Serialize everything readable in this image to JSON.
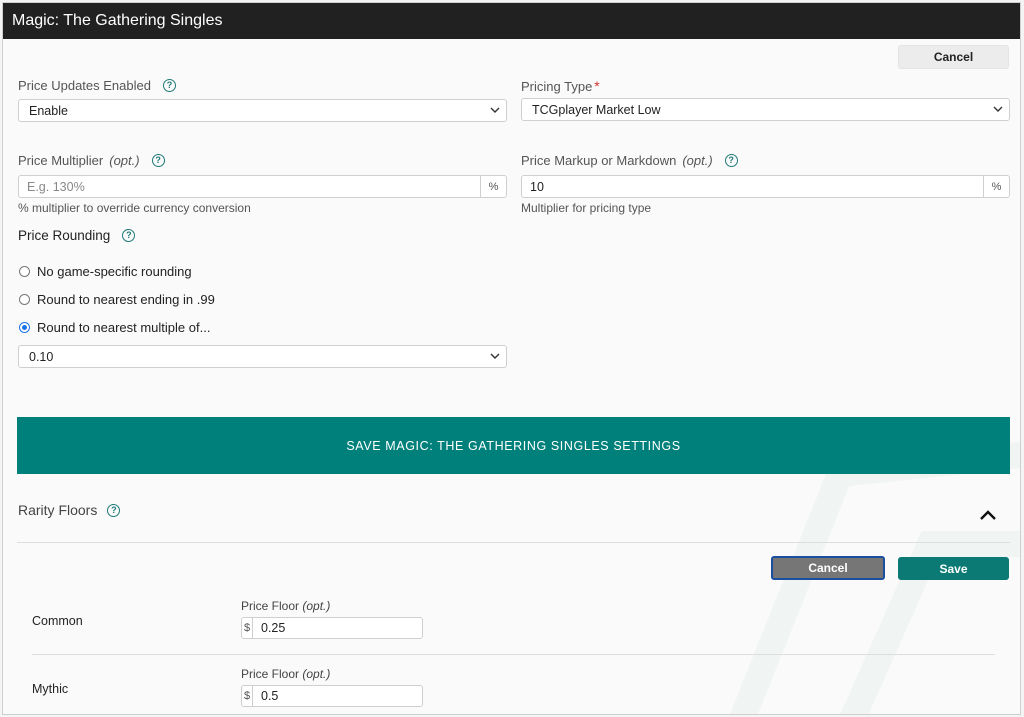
{
  "window": {
    "title": "Magic: The Gathering Singles"
  },
  "top_cancel_label": "Cancel",
  "price_updates": {
    "label": "Price Updates Enabled",
    "value": "Enable"
  },
  "pricing_type": {
    "label": "Pricing Type",
    "required_mark": "*",
    "value": "TCGplayer Market Low"
  },
  "price_multiplier": {
    "label": "Price Multiplier",
    "opt": "(opt.)",
    "placeholder": "E.g. 130%",
    "value": "",
    "unit": "%",
    "hint": "% multiplier to override currency conversion"
  },
  "price_markup": {
    "label": "Price Markup or Markdown",
    "opt": "(opt.)",
    "value": "10",
    "unit": "%",
    "hint": "Multiplier for pricing type"
  },
  "price_rounding": {
    "label": "Price Rounding",
    "options": [
      {
        "label": "No game-specific rounding",
        "checked": false
      },
      {
        "label": "Round to nearest ending in .99",
        "checked": false
      },
      {
        "label": "Round to nearest multiple of...",
        "checked": true
      }
    ],
    "multiple_value": "0.10"
  },
  "save_settings_label": "SAVE MAGIC: THE GATHERING SINGLES SETTINGS",
  "rarity_floors": {
    "title": "Rarity Floors",
    "cancel_label": "Cancel",
    "save_label": "Save",
    "rows": [
      {
        "name": "Common",
        "floor_label": "Price Floor",
        "opt": "(opt.)",
        "currency": "$",
        "value": "0.25"
      },
      {
        "name": "Mythic",
        "floor_label": "Price Floor",
        "opt": "(opt.)",
        "currency": "$",
        "value": "0.5"
      }
    ]
  },
  "help_icon_glyph": "?",
  "colors": {
    "accent": "#00807a",
    "titlebar": "#212121",
    "link": "#1f7a78",
    "radio": "#1a73e8",
    "required": "#d0342c"
  }
}
